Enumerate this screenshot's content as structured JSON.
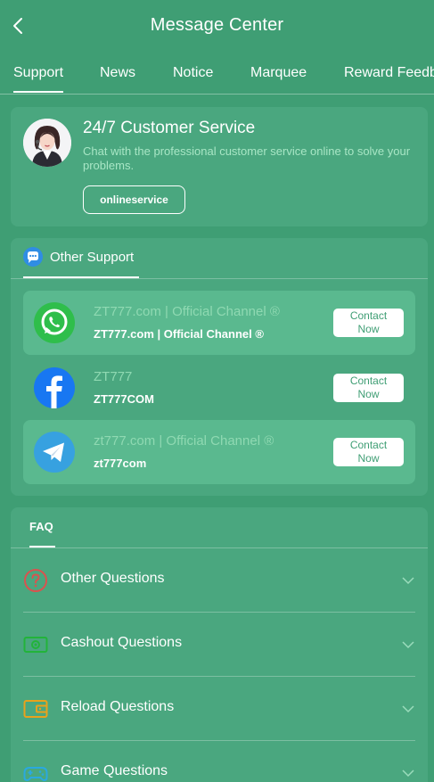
{
  "header": {
    "title": "Message Center"
  },
  "tabs": [
    {
      "label": "Support"
    },
    {
      "label": "News"
    },
    {
      "label": "Notice"
    },
    {
      "label": "Marquee"
    },
    {
      "label": "Reward Feedb"
    }
  ],
  "customer_service": {
    "title": "24/7 Customer Service",
    "description": "Chat with the professional customer service online to solve your problems.",
    "button_label": "onlineservice"
  },
  "other_support": {
    "tab_label": "Other Support",
    "contacts": [
      {
        "platform_icon": "whatsapp-icon",
        "title": "ZT777.com | Official Channel ®",
        "subtitle": "ZT777.com | Official Channel ®",
        "button_label": "Contact Now"
      },
      {
        "platform_icon": "facebook-icon",
        "title": "ZT777",
        "subtitle": "ZT777COM",
        "button_label": "Contact Now"
      },
      {
        "platform_icon": "telegram-icon",
        "title": "zt777.com | Official Channel ®",
        "subtitle": "zt777com",
        "button_label": "Contact Now"
      }
    ]
  },
  "faq": {
    "tab_label": "FAQ",
    "items": [
      {
        "label": "Other Questions",
        "icon": "question-icon"
      },
      {
        "label": "Cashout Questions",
        "icon": "cash-icon"
      },
      {
        "label": "Reload Questions",
        "icon": "wallet-icon"
      },
      {
        "label": "Game Questions",
        "icon": "gamepad-icon"
      }
    ]
  },
  "colors": {
    "background": "#3f9e74",
    "card": "#4aa77f",
    "row_highlight": "#5ab98f",
    "muted_text": "#8fd9b2"
  }
}
